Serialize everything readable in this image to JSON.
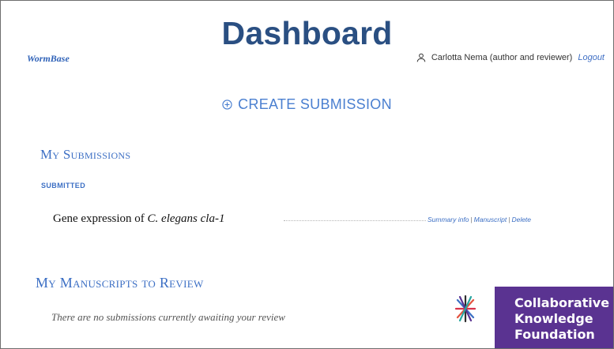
{
  "page": {
    "title": "Dashboard"
  },
  "header": {
    "brand": "WormBase",
    "user_icon": "user-icon",
    "user_name": "Carlotta Nema (author and reviewer)",
    "logout_label": "Logout"
  },
  "create": {
    "icon": "plus-circle-icon",
    "label": "CREATE SUBMISSION"
  },
  "my_submissions": {
    "heading": "My Submissions",
    "status_label": "SUBMITTED",
    "items": [
      {
        "title_prefix": "Gene expression of",
        "title_species": "C. elegans cla-1",
        "actions": [
          "Summary info",
          "Manuscript",
          "Delete"
        ]
      }
    ]
  },
  "my_reviews": {
    "heading": "My Manuscripts to Review",
    "empty_message": "There are no submissions currently awaiting your review"
  },
  "footer_logo": {
    "icon": "ckf-star-icon",
    "lines": [
      "Collaborative",
      "Knowledge",
      "Foundation"
    ],
    "color": "#5a3391"
  },
  "colors": {
    "title": "#2a4f82",
    "link": "#3c6fc4",
    "accent": "#4a7fd0"
  }
}
